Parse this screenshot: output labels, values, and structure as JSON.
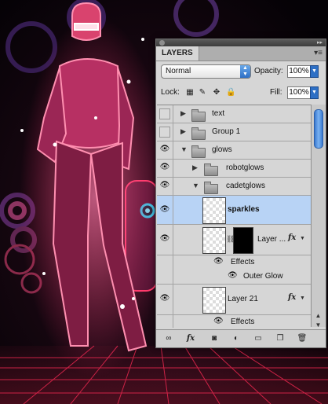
{
  "panel": {
    "tab_label": "LAYERS",
    "menu_icon": "panel-menu-icon",
    "blend_mode": "Normal",
    "opacity_label": "Opacity:",
    "opacity_value": "100%",
    "lock_label": "Lock:",
    "fill_label": "Fill:",
    "fill_value": "100%"
  },
  "layers": [
    {
      "name": "text",
      "kind": "group",
      "visible": false
    },
    {
      "name": "Group 1",
      "kind": "group",
      "visible": false
    },
    {
      "name": "glows",
      "kind": "group",
      "visible": true,
      "expanded": true
    },
    {
      "name": "robotglows",
      "kind": "group",
      "visible": true
    },
    {
      "name": "cadetglows",
      "kind": "group",
      "visible": true,
      "expanded": true
    },
    {
      "name": "sparkles",
      "kind": "layer",
      "visible": true,
      "selected": true
    },
    {
      "name": "Layer ...",
      "kind": "layer-mask",
      "visible": true,
      "fx": "fx"
    },
    {
      "name": "Effects",
      "kind": "effects-header"
    },
    {
      "name": "Outer Glow",
      "kind": "effect"
    },
    {
      "name": "Layer 21",
      "kind": "layer",
      "visible": true,
      "fx": "fx"
    },
    {
      "name": "Effects",
      "kind": "effects-header"
    }
  ],
  "footer_icons": [
    "link-icon",
    "fx-icon",
    "mask-icon",
    "adjustment-icon",
    "new-group-icon",
    "new-layer-icon",
    "trash-icon"
  ]
}
